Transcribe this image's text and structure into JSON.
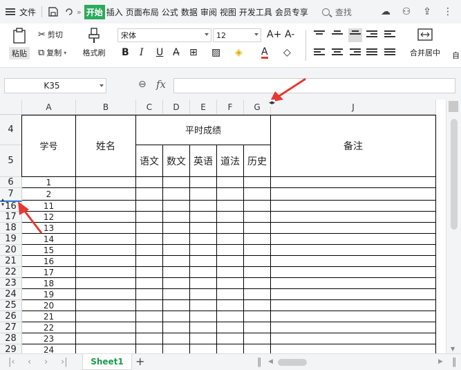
{
  "menubar": {
    "file_label": "文件",
    "tabs": [
      "开始",
      "插入",
      "页面布局",
      "公式",
      "数据",
      "审阅",
      "视图",
      "开发工具",
      "会员专享"
    ],
    "search_label": "查找"
  },
  "ribbon": {
    "paste_label": "粘贴",
    "cut_label": "剪切",
    "copy_label": "复制",
    "format_painter_label": "格式刷",
    "font_name": "宋体",
    "font_size": "12",
    "grow_font": "A+",
    "shrink_font": "A-",
    "bold": "B",
    "italic": "I",
    "underline": "U",
    "font_color_glyph": "A",
    "merge_center_label": "合并居中",
    "wrap_label": "自"
  },
  "formula_bar": {
    "name_box": "K35",
    "fx_label": "fx",
    "formula": ""
  },
  "grid": {
    "columns": [
      "A",
      "B",
      "C",
      "D",
      "E",
      "F",
      "G",
      "J"
    ],
    "header_rows": [
      "4",
      "5"
    ],
    "header": {
      "student_id": "学号",
      "name": "姓名",
      "usual_score": "平时成绩",
      "subjects": [
        "语文",
        "数文",
        "英语",
        "道法",
        "历史"
      ],
      "remark": "备注"
    },
    "rows": [
      {
        "row": "6",
        "id": "1"
      },
      {
        "row": "7",
        "id": "2"
      },
      {
        "row": "16",
        "id": "11"
      },
      {
        "row": "17",
        "id": "12"
      },
      {
        "row": "18",
        "id": "13"
      },
      {
        "row": "19",
        "id": "14"
      },
      {
        "row": "20",
        "id": "15"
      },
      {
        "row": "21",
        "id": "16"
      },
      {
        "row": "22",
        "id": "17"
      },
      {
        "row": "23",
        "id": "18"
      },
      {
        "row": "24",
        "id": "19"
      },
      {
        "row": "25",
        "id": "20"
      },
      {
        "row": "26",
        "id": "21"
      },
      {
        "row": "27",
        "id": "22"
      },
      {
        "row": "28",
        "id": "23"
      },
      {
        "row": "29",
        "id": "24"
      }
    ]
  },
  "sheets": {
    "active": "Sheet1",
    "add_label": "+"
  },
  "colors": {
    "accent": "#2bab5c",
    "arrow": "#e53935",
    "sheet_tab_text": "#1a9b4b"
  }
}
